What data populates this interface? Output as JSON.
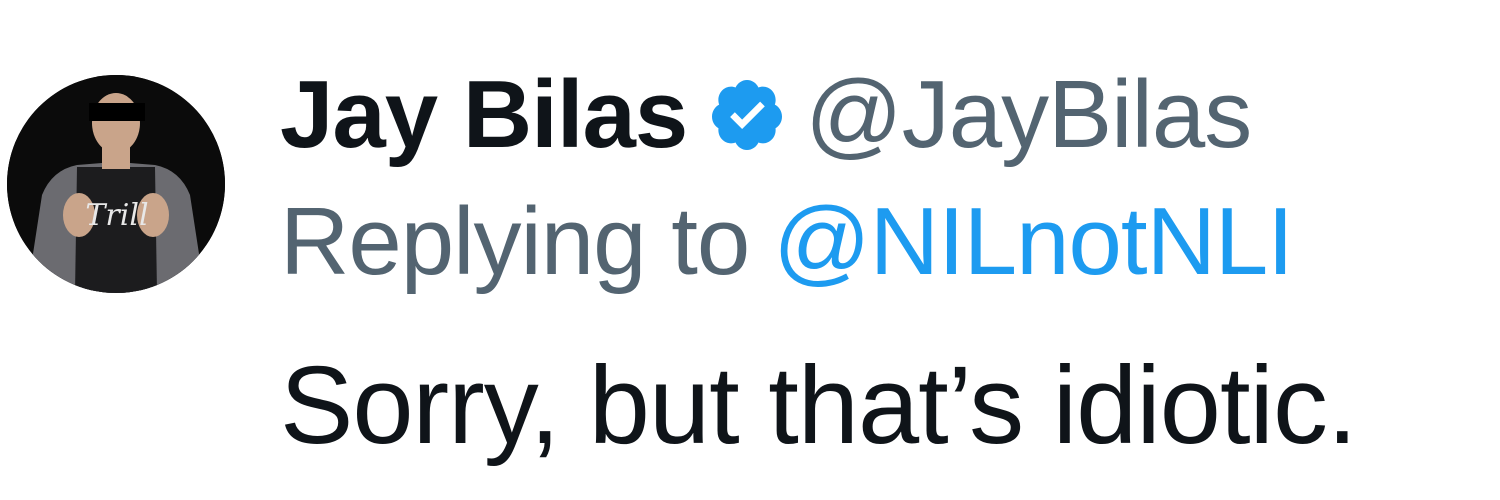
{
  "tweet": {
    "author": {
      "display_name": "Jay Bilas",
      "handle": "@JayBilas",
      "verified": true,
      "verified_icon": "verified-badge-icon",
      "avatar_icon": "profile-photo",
      "avatar_shirt_text": "Trill"
    },
    "reply": {
      "prefix": "Replying to",
      "handle": "@NILnotNLI"
    },
    "text": "Sorry, but that’s idiotic."
  },
  "colors": {
    "text_primary": "#0f1419",
    "text_secondary": "#536471",
    "link": "#1d9bf0",
    "verified": "#1d9bf0"
  }
}
